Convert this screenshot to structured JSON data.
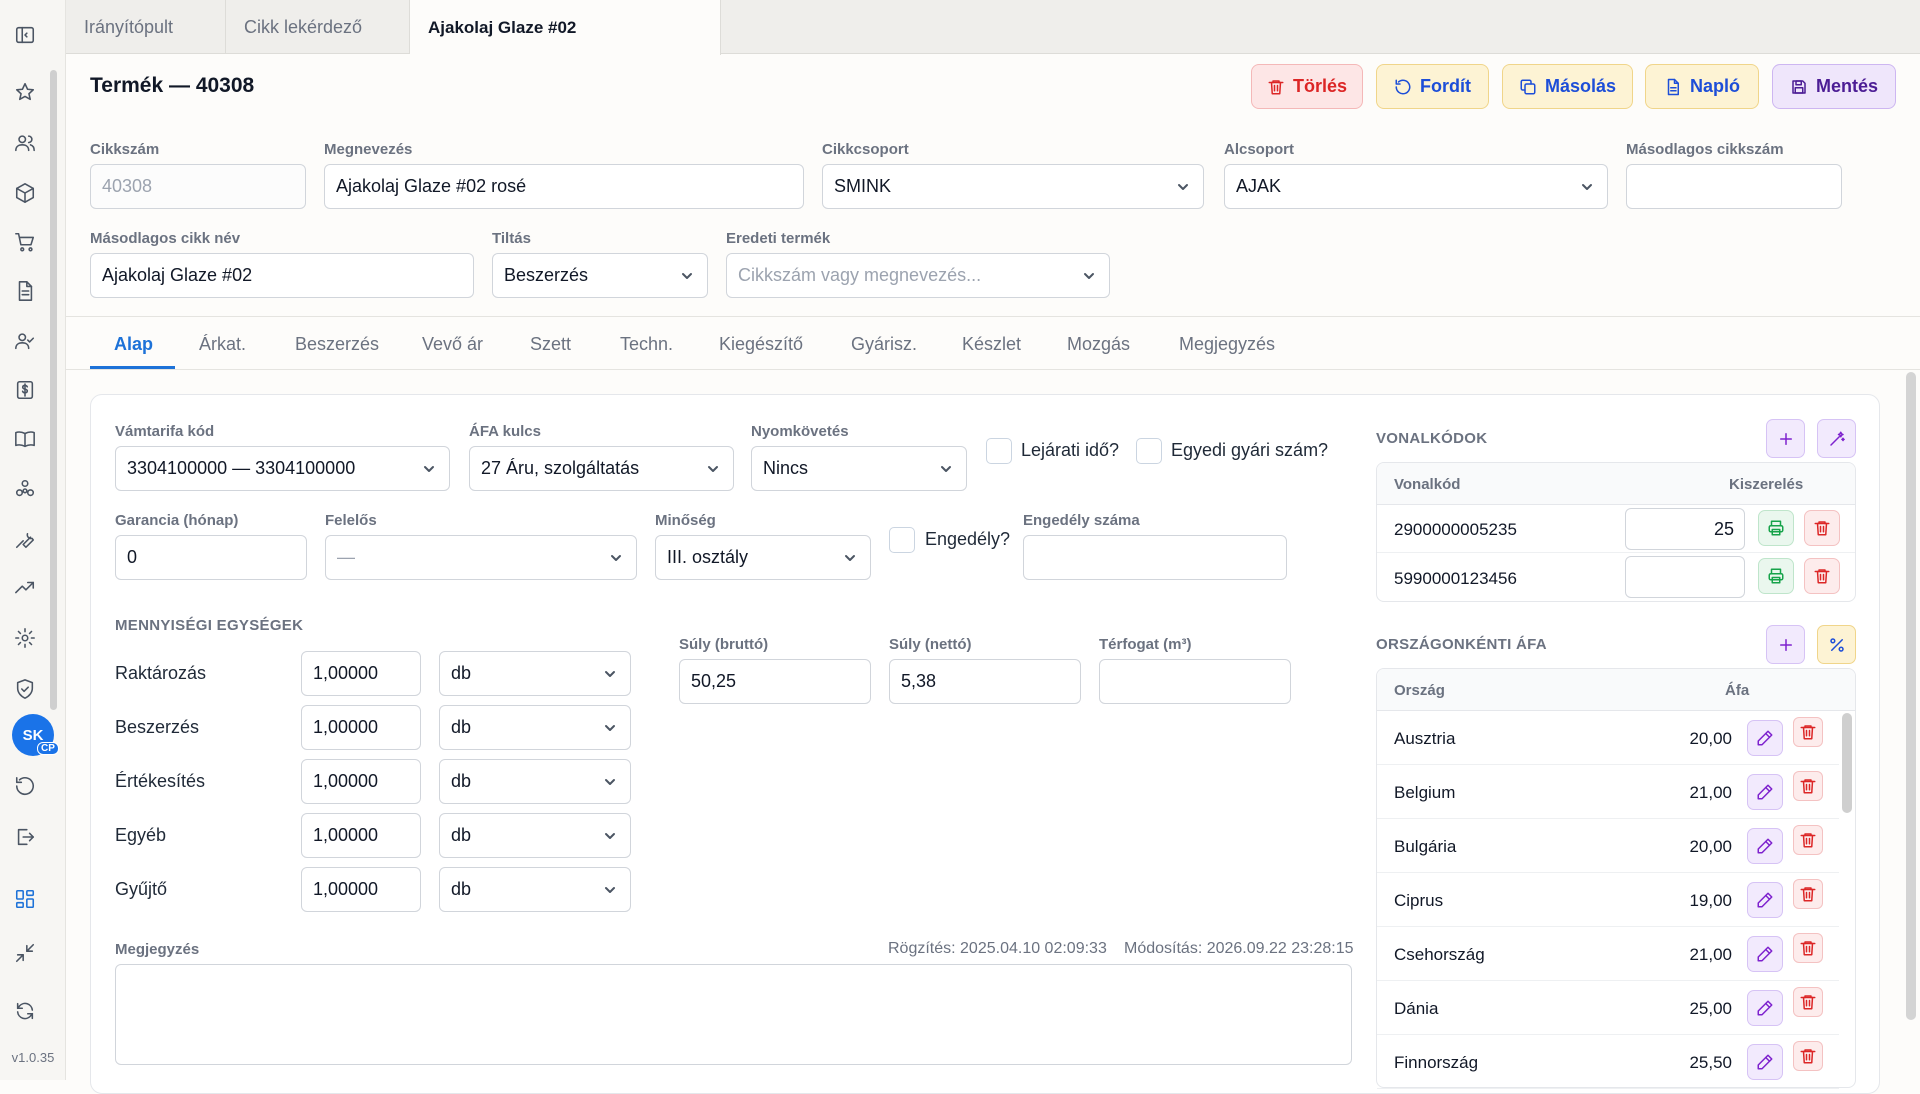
{
  "app": {
    "version": "v1.0.35",
    "user_initials": "SK",
    "user_badge": "CP"
  },
  "window_tabs": [
    {
      "label": "Irányítópult"
    },
    {
      "label": "Cikk lekérdező"
    },
    {
      "label": "Ajakolaj Glaze #02"
    }
  ],
  "header": {
    "title": "Termék — 40308",
    "buttons": {
      "delete": "Törlés",
      "translate": "Fordít",
      "copy": "Másolás",
      "log": "Napló",
      "save": "Mentés"
    }
  },
  "form": {
    "cikkszam": {
      "label": "Cikkszám",
      "value": "40308"
    },
    "megnevezes": {
      "label": "Megnevezés",
      "value": "Ajakolaj Glaze #02 rosé"
    },
    "cikkcsoport": {
      "label": "Cikkcsoport",
      "value": "SMINK"
    },
    "alcsoport": {
      "label": "Alcsoport",
      "value": "AJAK"
    },
    "masodlagos_cikkszam": {
      "label": "Másodlagos cikkszám",
      "value": ""
    },
    "masodlagos_cikk_nev": {
      "label": "Másodlagos cikk név",
      "value": "Ajakolaj Glaze #02"
    },
    "tiltas": {
      "label": "Tiltás",
      "value": "Beszerzés"
    },
    "eredeti_termek": {
      "label": "Eredeti termék",
      "placeholder": "Cikkszám vagy megnevezés..."
    }
  },
  "tabs": [
    "Alap",
    "Árkat.",
    "Beszerzés",
    "Vevő ár",
    "Szett",
    "Techn.",
    "Kiegészítő",
    "Gyárisz.",
    "Készlet",
    "Mozgás",
    "Megjegyzés"
  ],
  "basic": {
    "vamtarifa": {
      "label": "Vámtarifa kód",
      "value": "3304100000 — 3304100000"
    },
    "afa": {
      "label": "ÁFA kulcs",
      "value": "27 Áru, szolgáltatás"
    },
    "nyomkovetes": {
      "label": "Nyomkövetés",
      "value": "Nincs"
    },
    "lejarati": "Lejárati idő?",
    "egyedi": "Egyedi gyári szám?",
    "garancia": {
      "label": "Garancia (hónap)",
      "value": "0"
    },
    "felelos": {
      "label": "Felelős",
      "value": "—"
    },
    "minoseg": {
      "label": "Minőség",
      "value": "III. osztály"
    },
    "engedely": "Engedély?",
    "engedely_szama": {
      "label": "Engedély száma",
      "value": ""
    },
    "units_title": "MENNYISÉGI EGYSÉGEK",
    "units": [
      {
        "label": "Raktározás",
        "qty": "1,00000",
        "unit": "db"
      },
      {
        "label": "Beszerzés",
        "qty": "1,00000",
        "unit": "db"
      },
      {
        "label": "Értékesítés",
        "qty": "1,00000",
        "unit": "db"
      },
      {
        "label": "Egyéb",
        "qty": "1,00000",
        "unit": "db"
      },
      {
        "label": "Gyűjtő",
        "qty": "1,00000",
        "unit": "db"
      }
    ],
    "suly_brutto": {
      "label": "Súly (bruttó)",
      "value": "50,25"
    },
    "suly_netto": {
      "label": "Súly (nettó)",
      "value": "5,38"
    },
    "terfogat": {
      "label": "Térfogat (m³)",
      "value": ""
    },
    "megjegyzes_label": "Megjegyzés",
    "rogzites": "Rögzítés: 2025.04.10 02:09:33",
    "modositas": "Módosítás: 2026.09.22 23:28:15"
  },
  "barcodes": {
    "title": "VONALKÓDOK",
    "col_code": "Vonalkód",
    "col_pack": "Kiszerelés",
    "rows": [
      {
        "code": "2900000005235",
        "pack": "25"
      },
      {
        "code": "5990000123456",
        "pack": ""
      }
    ]
  },
  "vat": {
    "title": "ORSZÁGONKÉNTI ÁFA",
    "col_country": "Ország",
    "col_vat": "Áfa",
    "rows": [
      {
        "country": "Ausztria",
        "vat": "20,00"
      },
      {
        "country": "Belgium",
        "vat": "21,00"
      },
      {
        "country": "Bulgária",
        "vat": "20,00"
      },
      {
        "country": "Ciprus",
        "vat": "19,00"
      },
      {
        "country": "Csehország",
        "vat": "21,00"
      },
      {
        "country": "Dánia",
        "vat": "25,00"
      },
      {
        "country": "Finnország",
        "vat": "25,50"
      }
    ]
  }
}
